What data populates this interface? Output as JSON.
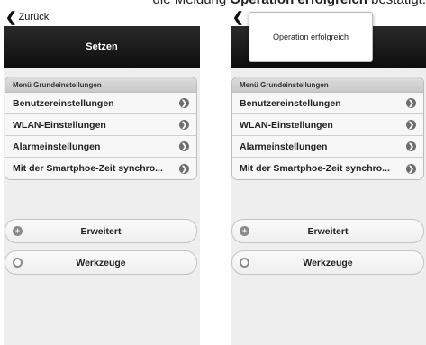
{
  "caption": {
    "prefix": "die Meldung ",
    "bold": "Operation erfolgreich",
    "suffix": " bestätigt."
  },
  "screens": [
    {
      "back_label": "Zurück",
      "title": "Setzen",
      "menu_header": "Menü Grundeinstellungen",
      "menu_items": [
        "Benutzereinstellungen",
        "WLAN-Einstellungen",
        "Alarmeinstellungen",
        "Mit der Smartphoe-Zeit synchro..."
      ],
      "advanced_label": "Erweitert",
      "tools_label": "Werkzeuge"
    },
    {
      "back_label": "",
      "title": "",
      "menu_header": "Menü Grundeinstellungen",
      "menu_items": [
        "Benutzereinstellungen",
        "WLAN-Einstellungen",
        "Alarmeinstellungen",
        "Mit der Smartphoe-Zeit synchro..."
      ],
      "advanced_label": "Erweitert",
      "tools_label": "Werkzeuge",
      "toast": "Operation erfolgreich"
    }
  ]
}
